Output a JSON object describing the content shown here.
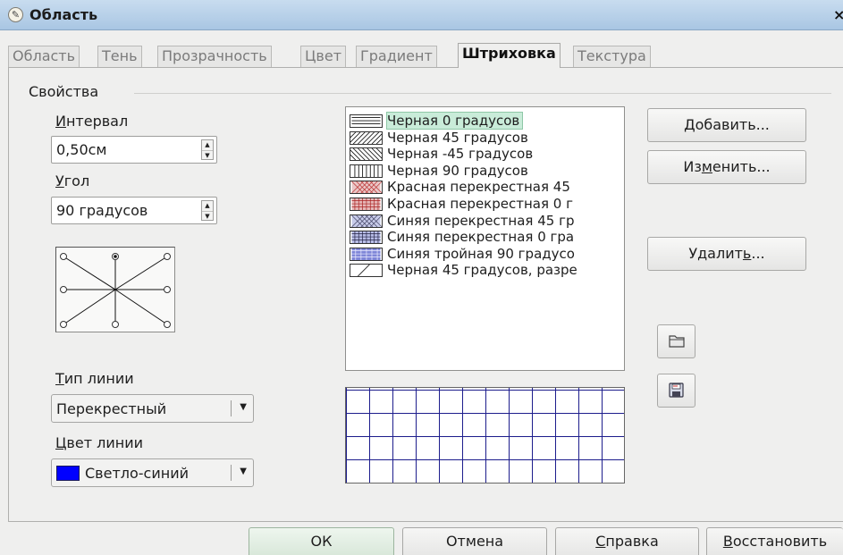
{
  "window": {
    "title": "Область",
    "close_symbol": "×"
  },
  "tabs": [
    {
      "label": "Область",
      "active": false
    },
    {
      "label": "Тень",
      "active": false
    },
    {
      "label": "Прозрачность",
      "active": false
    },
    {
      "label": "Цвет",
      "active": false
    },
    {
      "label": "Градиент",
      "active": false
    },
    {
      "label": "Штриховка",
      "active": true
    },
    {
      "label": "Текстура",
      "active": false
    }
  ],
  "properties": {
    "group_label": "Свойства",
    "interval_label_pre": "И",
    "interval_label_rest": "нтервал",
    "interval_value": "0,50см",
    "angle_label_pre": "У",
    "angle_label_rest": "гол",
    "angle_value": "90 градусов",
    "line_type_label_pre": "Т",
    "line_type_label_rest": "ип линии",
    "line_type_value": "Перекрестный",
    "line_color_label_pre": "Ц",
    "line_color_label_rest": "вет линии",
    "line_color_value": "Светло-синий",
    "line_color_hex": "#0000ff"
  },
  "hatch_list": [
    {
      "label": "Черная 0 градусов",
      "selected": true,
      "pattern": "horizontal-black"
    },
    {
      "label": "Черная 45 градусов",
      "selected": false,
      "pattern": "diag45-black"
    },
    {
      "label": "Черная -45 градусов",
      "selected": false,
      "pattern": "diag-45-black"
    },
    {
      "label": "Черная 90 градусов",
      "selected": false,
      "pattern": "vertical-black"
    },
    {
      "label": "Красная перекрестная 45",
      "selected": false,
      "pattern": "cross45-red"
    },
    {
      "label": "Красная перекрестная 0 г",
      "selected": false,
      "pattern": "cross0-red"
    },
    {
      "label": "Синяя перекрестная 45 гр",
      "selected": false,
      "pattern": "cross45-blue"
    },
    {
      "label": "Синяя перекрестная 0 гра",
      "selected": false,
      "pattern": "cross0-blue"
    },
    {
      "label": "Синяя тройная 90 градусо",
      "selected": false,
      "pattern": "triple-blue"
    },
    {
      "label": "Черная 45 градусов, разре",
      "selected": false,
      "pattern": "sparse45-black"
    }
  ],
  "buttons": {
    "add_pre": "Д",
    "add_rest": "обавить...",
    "modify_pre": "Из",
    "modify_u": "м",
    "modify_rest": "енить...",
    "delete_pre": "Удалит",
    "delete_u": "ь",
    "delete_rest": "..."
  },
  "footer": {
    "ok": "ОК",
    "cancel": "Отмена",
    "help_u": "С",
    "help_rest": "правка",
    "reset_u": "В",
    "reset_rest": "осстановить"
  },
  "colors": {
    "titlebar": "#b4cfe9",
    "selection": "#c9ecd9",
    "grid": "#1d1d8c"
  }
}
